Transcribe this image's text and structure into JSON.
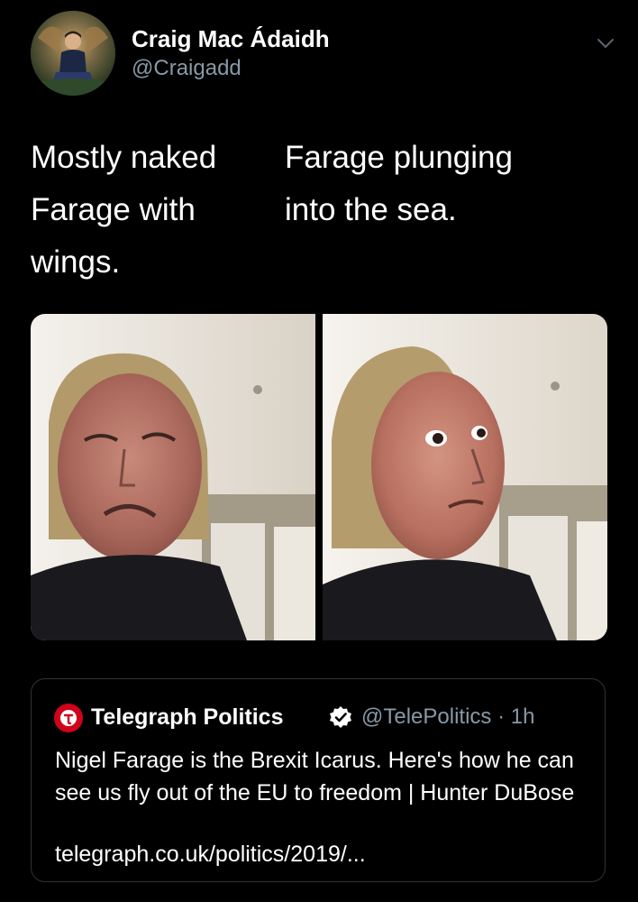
{
  "tweet": {
    "author": {
      "name": "Craig Mac Ádaidh",
      "handle": "@Craigadd",
      "avatar_icon": "avatar-photo"
    },
    "menu_icon": "chevron-down-icon",
    "text": {
      "left_column": [
        "Mostly naked",
        "Farage with",
        "wings."
      ],
      "right_column": [
        "Farage plunging",
        "into the sea."
      ]
    },
    "media": {
      "panels": [
        "reaction-disgust-photo",
        "reaction-interested-photo"
      ]
    }
  },
  "quoted_tweet": {
    "author_name": "Telegraph Politics",
    "verified_icon": "verified-badge-icon",
    "handle_time": "@TelePolitics · 1h",
    "body": "Nigel Farage is the Brexit Icarus. Here's how he can see us fly out of the EU to freedom | Hunter DuBose",
    "link": "telegraph.co.uk/politics/2019/...",
    "logo_icon": "telegraph-logo-icon",
    "colors": {
      "logo_red": "#d0021b",
      "verified_white": "#ffffff"
    }
  },
  "colors": {
    "background": "#000000",
    "text_primary": "#ffffff",
    "text_secondary": "#8899a6",
    "border": "#2f3336"
  }
}
